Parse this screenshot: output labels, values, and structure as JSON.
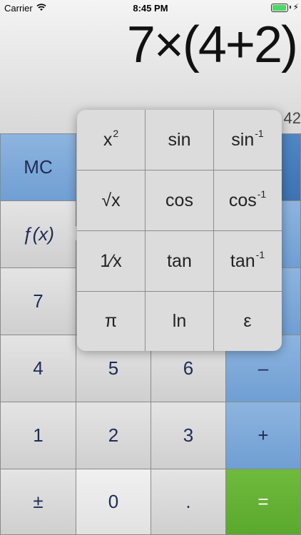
{
  "status_bar": {
    "carrier": "Carrier",
    "time": "8:45 PM"
  },
  "display": {
    "expression": "7×(4+2)",
    "result": "42"
  },
  "keys": {
    "mc": "MC",
    "fx": "ƒ(x)",
    "seven": "7",
    "four": "4",
    "five": "5",
    "six": "6",
    "minus": "–",
    "one": "1",
    "two": "2",
    "three": "3",
    "plus": "+",
    "plus_minus": "±",
    "zero": "0",
    "decimal": ".",
    "equals": "="
  },
  "functions": {
    "square": "x",
    "square_sup": "2",
    "sin": "sin",
    "asin": "sin",
    "asin_sup": "-1",
    "sqrt": "√x",
    "cos": "cos",
    "acos": "cos",
    "acos_sup": "-1",
    "reciprocal": "1⁄x",
    "tan": "tan",
    "atan": "tan",
    "atan_sup": "-1",
    "pi": "π",
    "ln": "ln",
    "e": "ε"
  },
  "colors": {
    "blue_key": "#7aa7d9",
    "dark_blue_key": "#3d73b3",
    "green_key": "#5aa82d"
  }
}
